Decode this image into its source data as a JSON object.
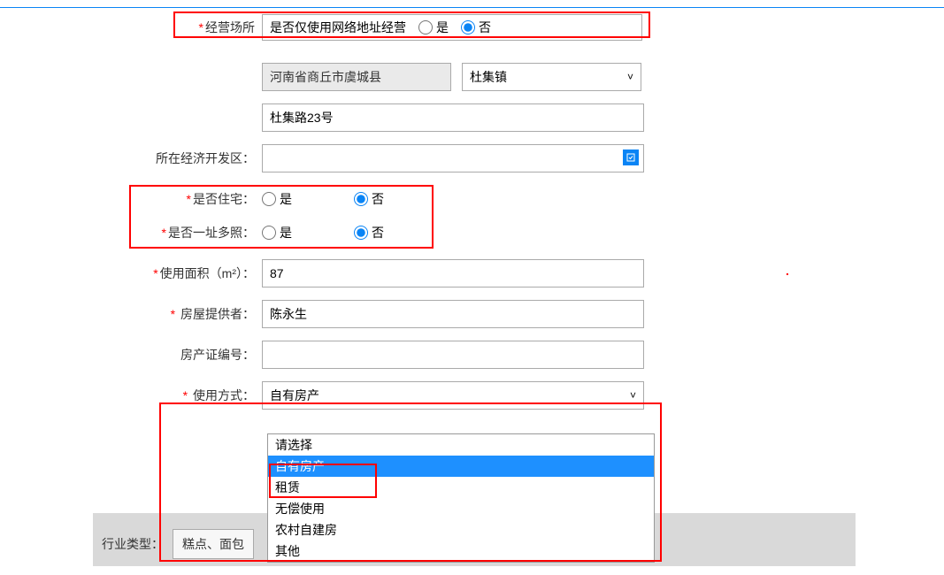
{
  "labels": {
    "business_place": "经营场所",
    "net_only_question": "是否仅使用网络地址经营",
    "yes": "是",
    "no": "否",
    "dev_zone": "所在经济开发区：",
    "is_residence": "是否住宅：",
    "multi_license": "是否一址多照：",
    "area": "使用面积（m²）：",
    "house_provider": "房屋提供者：",
    "property_cert_no": "房产证编号：",
    "use_mode": "使用方式：",
    "industry_type": "行业类型：",
    "asterisk": "*"
  },
  "values": {
    "region_readonly": "河南省商丘市虞城县",
    "town_select": "杜集镇",
    "address_detail": "杜集路23号",
    "dev_zone_value": "",
    "area_value": "87",
    "house_provider_value": "陈永生",
    "property_cert_value": "",
    "use_mode_selected": "自有房产",
    "industry_button": "糕点、面包"
  },
  "dropdown": {
    "options": [
      "请选择",
      "自有房产",
      "租赁",
      "无偿使用",
      "农村自建房",
      "其他"
    ],
    "selected_index": 1
  },
  "misc": {
    "red_dot": "."
  }
}
